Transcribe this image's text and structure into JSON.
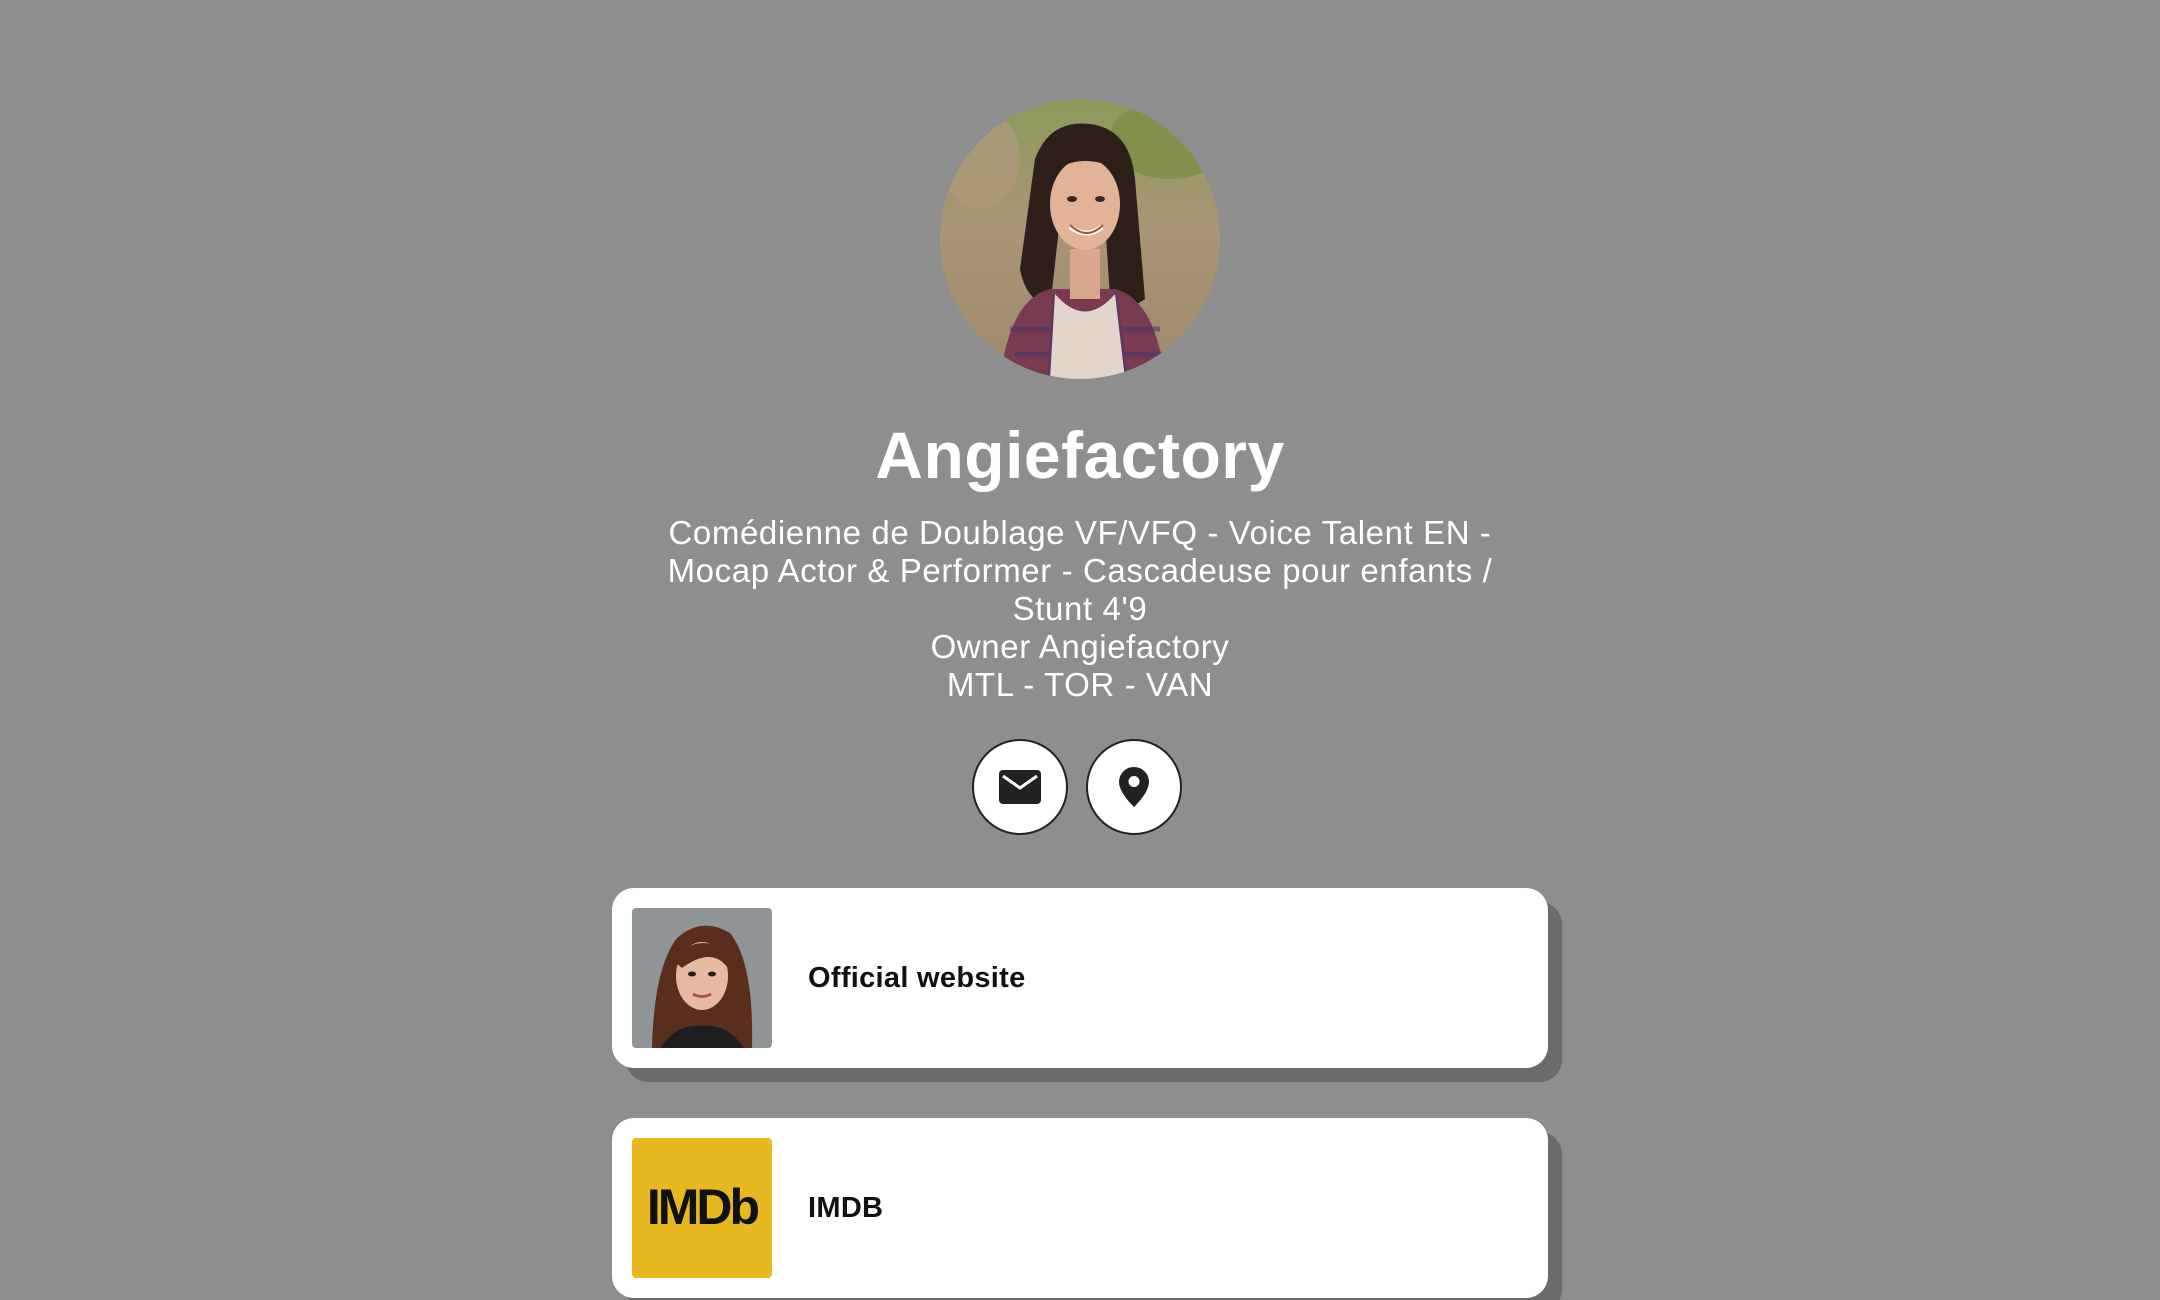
{
  "profile": {
    "name": "Angiefactory",
    "bio_lines": [
      "Comédienne de Doublage VF/VFQ - Voice Talent EN -",
      "Mocap Actor & Performer - Cascadeuse pour enfants /",
      "Stunt 4'9",
      "Owner Angiefactory",
      "MTL - TOR - VAN"
    ]
  },
  "social": [
    {
      "icon": "mail-icon"
    },
    {
      "icon": "location-pin-icon"
    }
  ],
  "links": [
    {
      "label": "Official website",
      "thumbnail": "portrait-photo"
    },
    {
      "label": "IMDB",
      "thumbnail": "imdb-logo",
      "logo_text": "IMDb"
    }
  ],
  "colors": {
    "background": "#8e8e8e",
    "card": "#ffffff",
    "card_shadow": "#6b6b6b",
    "imdb_yellow": "#e5b91f"
  }
}
